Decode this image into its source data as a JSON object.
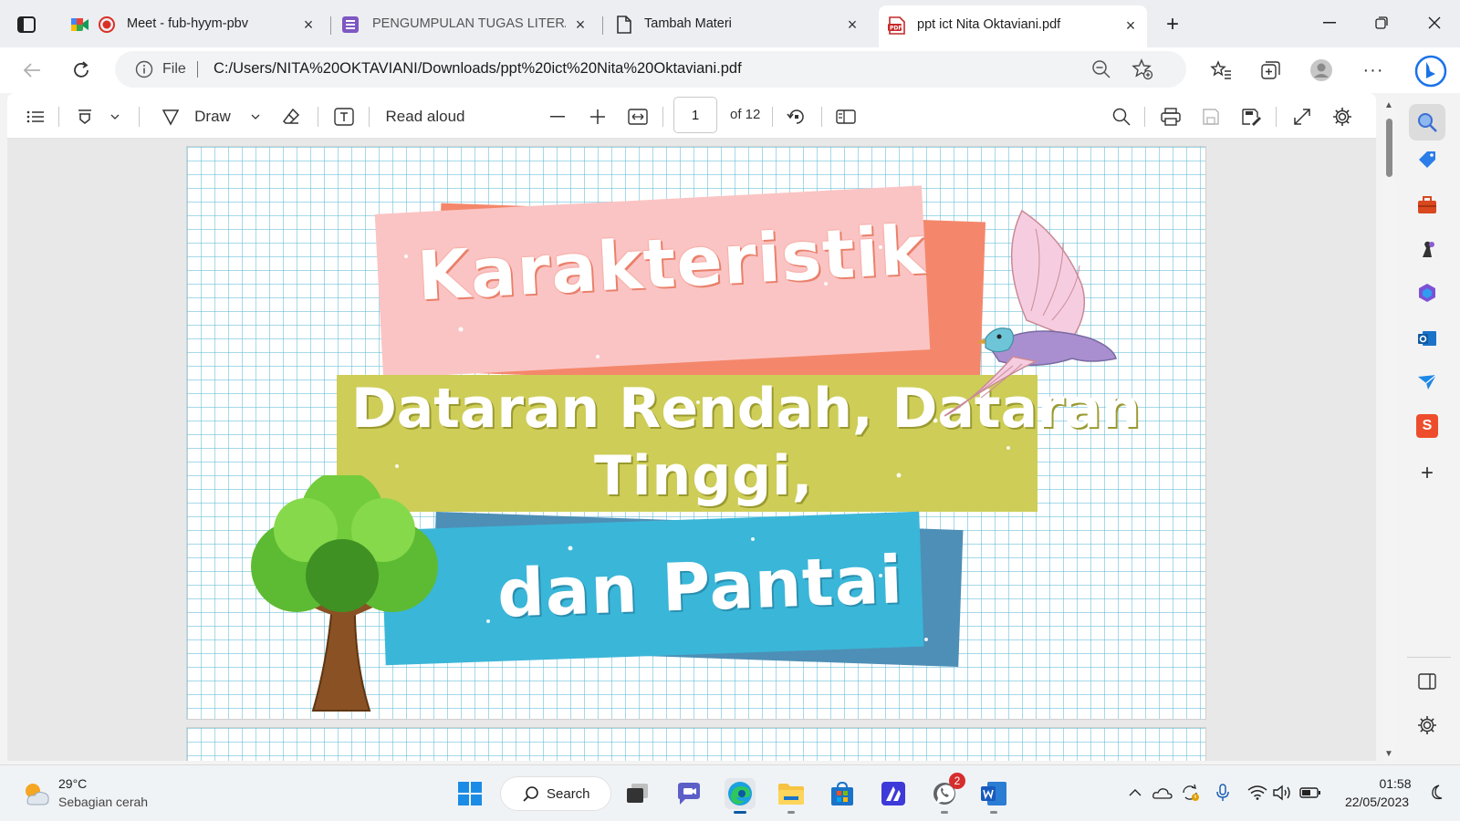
{
  "browser": {
    "tabs": [
      {
        "label": "Meet - fub-hyym-pbv",
        "active": false
      },
      {
        "label": "PENGUMPULAN TUGAS LITERASI",
        "active": false
      },
      {
        "label": "Tambah Materi",
        "active": false
      },
      {
        "label": "ppt ict Nita Oktaviani.pdf",
        "active": true
      }
    ],
    "new_tab_label": "+",
    "address_bar": {
      "scheme_label": "File",
      "url": "C:/Users/NITA%20OKTAVIANI/Downloads/ppt%20ict%20Nita%20Oktaviani.pdf"
    }
  },
  "pdf_toolbar": {
    "draw_label": "Draw",
    "read_aloud_label": "Read aloud",
    "page_number": "1",
    "page_count_label": "of 12"
  },
  "slide": {
    "title_line1": "Karakteristik",
    "title_line2": "Dataran Rendah, Dataran",
    "title_line3": "Tinggi,",
    "title_line4": "dan Pantai"
  },
  "taskbar": {
    "weather": {
      "temperature": "29°C",
      "description": "Sebagian cerah"
    },
    "search_label": "Search",
    "whatsapp_badge": "2",
    "clock": {
      "time": "01:58",
      "date": "22/05/2023"
    }
  },
  "colors": {
    "pink_banner": "#fbc4c4",
    "salmon_banner": "#f4876b",
    "olive_banner": "#cdcd58",
    "blue_banner": "#3ab6d8",
    "steel_banner": "#4d8fb6",
    "edge_accent": "#0c59a4"
  }
}
